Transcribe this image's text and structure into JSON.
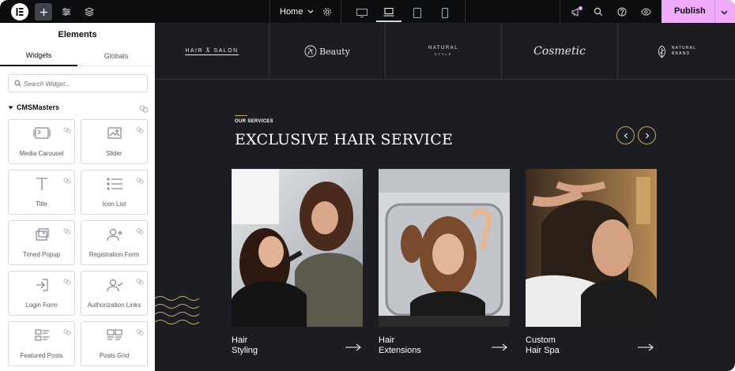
{
  "topbar": {
    "page_name": "Home",
    "publish_label": "Publish"
  },
  "panel": {
    "title": "Elements",
    "tabs": [
      {
        "label": "Widgets"
      },
      {
        "label": "Globals"
      }
    ],
    "search_placeholder": "Search Widget...",
    "category": "CMSMasters",
    "widgets": [
      {
        "label": "Media Carousel"
      },
      {
        "label": "Slider"
      },
      {
        "label": "Title"
      },
      {
        "label": "Icon List"
      },
      {
        "label": "Timed Popup"
      },
      {
        "label": "Registration Form"
      },
      {
        "label": "Login Form"
      },
      {
        "label": "Authorization Links"
      },
      {
        "label": "Featured Posts"
      },
      {
        "label": "Posts Grid"
      }
    ]
  },
  "canvas": {
    "brands": [
      {
        "top": "HAIR",
        "mid": "X",
        "bottom": "SALON"
      },
      {
        "name": "Beauty"
      },
      {
        "name": "NATURAL",
        "sub": "STYLE"
      },
      {
        "name": "Cosmetic"
      },
      {
        "name": "NATURAL",
        "sub": "BRAND"
      }
    ],
    "eyebrow": "OUR SERVICES",
    "heading": "EXCLUSIVE HAIR SERVICE",
    "cards": [
      {
        "line1": "Hair",
        "line2": "Styling"
      },
      {
        "line1": "Hair",
        "line2": "Extensions"
      },
      {
        "line1": "Custom",
        "line2": "Hair Spa"
      }
    ]
  },
  "colors": {
    "publish_bg": "#f0abfc",
    "canvas_bg": "#1b1d23",
    "accent_gold": "#c9a96e",
    "topbar_bg": "#0c0d0e"
  }
}
